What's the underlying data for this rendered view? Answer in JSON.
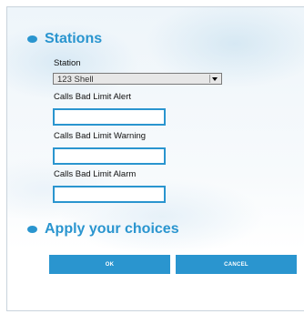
{
  "stations": {
    "heading": "Stations",
    "station_label": "Station",
    "station_value": "123 Shell",
    "alert_label": "Calls Bad Limit Alert",
    "alert_value": "",
    "warning_label": "Calls Bad Limit Warning",
    "warning_value": "",
    "alarm_label": "Calls Bad Limit Alarm",
    "alarm_value": ""
  },
  "apply": {
    "heading": "Apply your choices",
    "ok_label": "OK",
    "cancel_label": "CANCEL"
  },
  "colors": {
    "accent": "#2a95cf"
  },
  "icons": {
    "section_bullet": "bullet-icon",
    "dropdown": "chevron-down-icon"
  }
}
